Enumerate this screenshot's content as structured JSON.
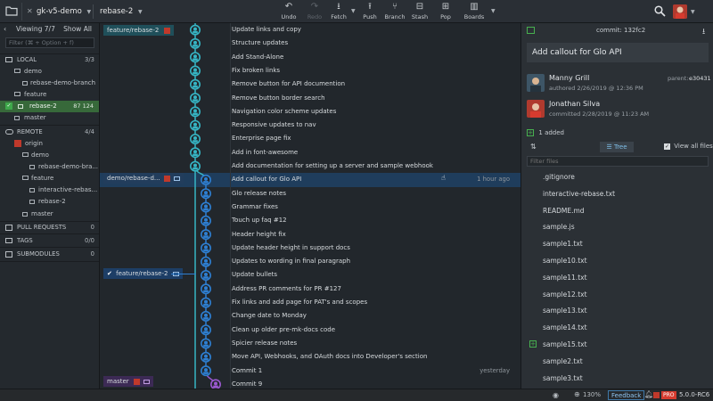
{
  "toolbar": {
    "repo_tab": "gk-v5-demo",
    "branch_tab": "rebase-2",
    "buttons": [
      {
        "label": "Undo",
        "icon": "undo-icon",
        "enabled": true
      },
      {
        "label": "Redo",
        "icon": "redo-icon",
        "enabled": false
      },
      {
        "label": "Fetch",
        "icon": "fetch-icon",
        "enabled": true
      },
      {
        "label": "Push",
        "icon": "push-icon",
        "enabled": true
      },
      {
        "label": "Branch",
        "icon": "branch-icon",
        "enabled": true
      },
      {
        "label": "Stash",
        "icon": "stash-icon",
        "enabled": true
      },
      {
        "label": "Pop",
        "icon": "pop-icon",
        "enabled": true
      },
      {
        "label": "Boards",
        "icon": "boards-icon",
        "enabled": true
      }
    ]
  },
  "left_panel": {
    "viewing": "Viewing 7/7",
    "show_all": "Show All",
    "filter_placeholder": "Filter (⌘ + Option + f)",
    "local": {
      "label": "LOCAL",
      "count": "3/3"
    },
    "local_items": [
      "demo",
      "rebase-demo-branch",
      "feature",
      "rebase-2",
      "master"
    ],
    "rebase_ahead_behind": "87 124",
    "remote": {
      "label": "REMOTE",
      "count": "4/4"
    },
    "remote_items": [
      "origin",
      "demo",
      "rebase-demo-bra...",
      "feature",
      "interactive-rebas...",
      "rebase-2",
      "master"
    ],
    "pull_requests": {
      "label": "PULL REQUESTS",
      "count": "0"
    },
    "tags": {
      "label": "TAGS",
      "count": "0/0"
    },
    "submodules": {
      "label": "SUBMODULES",
      "count": "0"
    }
  },
  "graph": {
    "ref_labels": {
      "feature_rebase_top": "feature/rebase-2",
      "demo_rebase": "demo/rebase-d...",
      "feature_rebase_check": "feature/rebase-2",
      "master": "master"
    },
    "commits": [
      "Update links and copy",
      "Structure updates",
      "Add Stand-Alone",
      "Fix broken links",
      "Remove button for API documention",
      "Remove button border search",
      "Navigation color scheme updates",
      "Responsive updates to nav",
      "Enterprise page fix",
      "Add in font-awesome",
      "Add documentation for setting up a server and sample webhook",
      "Add callout for Glo API",
      "Glo release notes",
      "Grammar fixes",
      "Touch up faq #12",
      "Header height fix",
      "Update header height in support docs",
      "Updates to wording in final paragraph",
      "Update bullets",
      "Address PR comments for PR #127",
      "Fix links and add page for PAT's and scopes",
      "Change date to Monday",
      "Clean up older pre-mk-docs code",
      "Spicier release notes",
      "Move API, Webhooks, and OAuth docs into Developer's section",
      "Commit 1",
      "Commit 9"
    ],
    "selected_time": "1 hour ago",
    "commit1_time": "yesterday"
  },
  "right_panel": {
    "commit_label": "commit: 132fc2",
    "title": "Add callout for Glo API",
    "author_name": "Manny Grill",
    "authored": "authored 2/26/2019 @ 12:36 PM",
    "parent_label": "parent:",
    "parent": "e30431",
    "committer_name": "Jonathan Silva",
    "committed": "committed 2/28/2019 @ 11:23 AM",
    "added": "1 added",
    "tree_label": "Tree",
    "view_all": "View all files",
    "filter_placeholder": "Filter files",
    "files": [
      ".gitignore",
      "interactive-rebase.txt",
      "README.md",
      "sample.js",
      "sample1.txt",
      "sample10.txt",
      "sample11.txt",
      "sample12.txt",
      "sample13.txt",
      "sample14.txt",
      "sample15.txt",
      "sample2.txt",
      "sample3.txt"
    ]
  },
  "status_bar": {
    "zoom": "130%",
    "feedback": "Feedback",
    "pro": "PRO",
    "version": "5.0.0-RC6"
  },
  "colors": {
    "accent_green": "#3f8a43",
    "graph_cyan": "#36b5c4",
    "graph_blue": "#2e7fd2",
    "graph_purple": "#9b59d0",
    "selection_blue": "#1f3d5c"
  }
}
